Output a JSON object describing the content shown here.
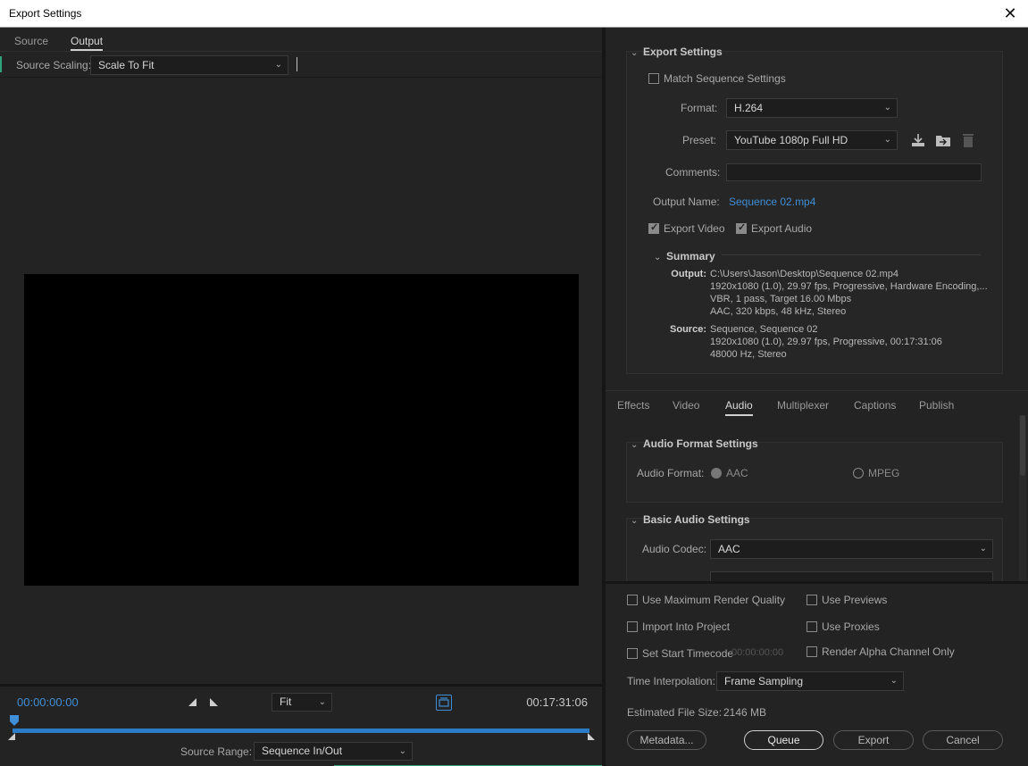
{
  "window": {
    "title": "Export Settings",
    "close": "✕"
  },
  "left": {
    "tabs": [
      {
        "label": "Source"
      },
      {
        "label": "Output"
      }
    ],
    "source_scaling": {
      "label": "Source Scaling:",
      "value": "Scale To Fit"
    },
    "timeline": {
      "current_time": "00:00:00:00",
      "duration": "00:17:31:06",
      "fit_value": "Fit",
      "source_range_label": "Source Range:",
      "source_range_value": "Sequence In/Out"
    }
  },
  "export_settings": {
    "heading": "Export Settings",
    "match_sequence": {
      "label": "Match Sequence Settings",
      "checked": false
    },
    "format": {
      "label": "Format:",
      "value": "H.264"
    },
    "preset": {
      "label": "Preset:",
      "value": "YouTube 1080p Full HD"
    },
    "comments": {
      "label": "Comments:",
      "value": ""
    },
    "output_name": {
      "label": "Output Name:",
      "value": "Sequence 02.mp4"
    },
    "export_video": {
      "label": "Export Video",
      "checked": true
    },
    "export_audio": {
      "label": "Export Audio",
      "checked": true
    },
    "summary": {
      "heading": "Summary",
      "output_key": "Output:",
      "output_lines": [
        "C:\\Users\\Jason\\Desktop\\Sequence 02.mp4",
        "1920x1080 (1.0), 29.97 fps, Progressive, Hardware Encoding,...",
        "VBR, 1 pass, Target 16.00 Mbps",
        "AAC, 320 kbps, 48 kHz, Stereo"
      ],
      "source_key": "Source:",
      "source_lines": [
        "Sequence, Sequence 02",
        "1920x1080 (1.0), 29.97 fps, Progressive, 00:17:31:06",
        "48000 Hz, Stereo"
      ]
    }
  },
  "settings_tabs": [
    {
      "label": "Effects"
    },
    {
      "label": "Video"
    },
    {
      "label": "Audio"
    },
    {
      "label": "Multiplexer"
    },
    {
      "label": "Captions"
    },
    {
      "label": "Publish"
    }
  ],
  "audio": {
    "format_heading": "Audio Format Settings",
    "format_label": "Audio Format:",
    "option_aac": "AAC",
    "option_mpeg": "MPEG",
    "basic_heading": "Basic Audio Settings",
    "codec_label": "Audio Codec:",
    "codec_value": "AAC"
  },
  "options": {
    "max_render_quality": {
      "label": "Use Maximum Render Quality",
      "checked": false
    },
    "use_previews": {
      "label": "Use Previews",
      "checked": false
    },
    "import_into_project": {
      "label": "Import Into Project",
      "checked": false
    },
    "use_proxies": {
      "label": "Use Proxies",
      "checked": false
    },
    "set_start_timecode": {
      "label": "Set Start Timecode",
      "checked": false,
      "value": "00:00:00:00"
    },
    "render_alpha": {
      "label": "Render Alpha Channel Only",
      "checked": false
    },
    "time_interpolation": {
      "label": "Time Interpolation:",
      "value": "Frame Sampling"
    },
    "estimated_size": {
      "label": "Estimated File Size:",
      "value": "2146 MB"
    }
  },
  "buttons": {
    "metadata": "Metadata...",
    "queue": "Queue",
    "export": "Export",
    "cancel": "Cancel"
  },
  "colors": {
    "accent": "#3f8ed6",
    "background": "#232323"
  }
}
